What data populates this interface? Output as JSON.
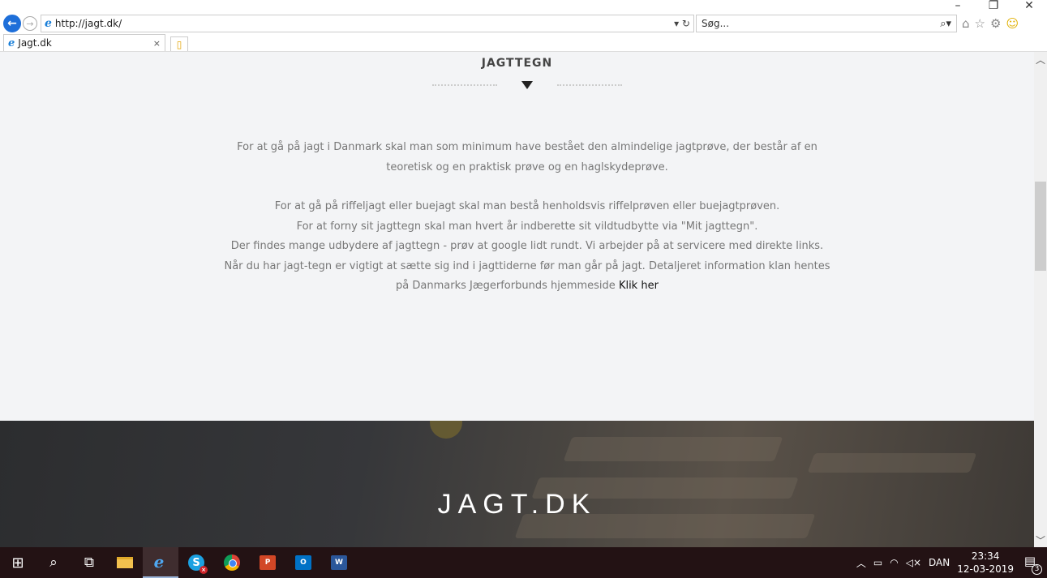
{
  "browser": {
    "url": "http://jagt.dk/",
    "search_placeholder": "Søg...",
    "tab_title": "Jagt.dk",
    "tab_close": "×",
    "url_actions": "▾ ↻",
    "window_controls": {
      "minimize": "–",
      "restore": "❐",
      "close": "✕"
    }
  },
  "page": {
    "section_title": "JAGTTEGN",
    "paragraphs": [
      "For at gå på jagt i Danmark skal man som minimum have bestået den almindelige jagtprøve, der består af en teoretisk og en praktisk prøve og en haglskydeprøve."
    ],
    "lines": [
      "For at gå på riffeljagt eller buejagt skal man bestå henholdsvis riffelprøven eller buejagtprøven.",
      "For at forny sit jagttegn skal man hvert år indberette sit vildtudbytte via \"Mit jagttegn\".",
      "Der findes mange udbydere af jagttegn - prøv at google lidt rundt. Vi arbejder på at servicere med direkte links.",
      "Når du har jagt-tegn er vigtigt at sætte sig ind i jagttiderne før man går på jagt. Detaljeret information klan hentes på Danmarks Jægerforbunds hjemmeside"
    ],
    "link_text": "Klik her",
    "footer_brand": "JAGT.DK"
  },
  "taskbar": {
    "tray_language": "DAN",
    "time": "23:34",
    "date": "12-03-2019",
    "notification_count": "3"
  }
}
